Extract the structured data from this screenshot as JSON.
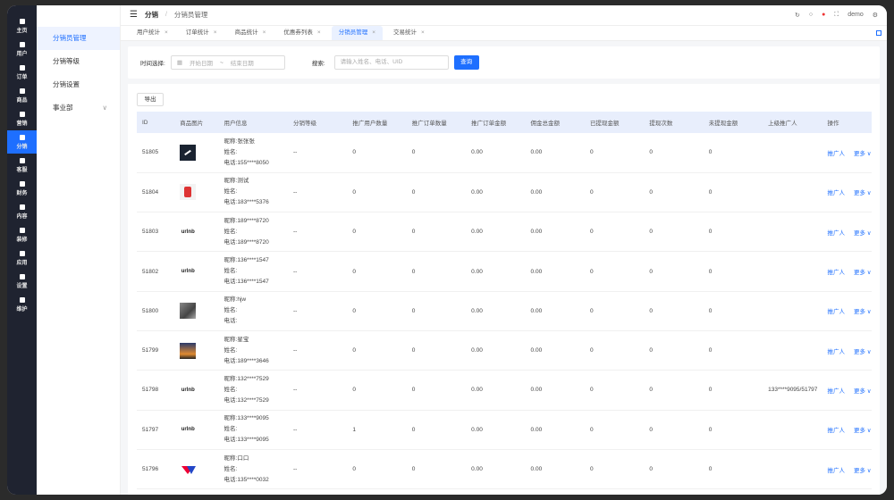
{
  "rail": {
    "items": [
      {
        "label": "主页",
        "active": false
      },
      {
        "label": "用户",
        "active": false
      },
      {
        "label": "订单",
        "active": false
      },
      {
        "label": "商品",
        "active": false
      },
      {
        "label": "营销",
        "active": false
      },
      {
        "label": "分销",
        "active": true
      },
      {
        "label": "客服",
        "active": false
      },
      {
        "label": "财务",
        "active": false
      },
      {
        "label": "内容",
        "active": false
      },
      {
        "label": "装修",
        "active": false
      },
      {
        "label": "应用",
        "active": false
      },
      {
        "label": "设置",
        "active": false
      },
      {
        "label": "维护",
        "active": false
      }
    ]
  },
  "submenu": {
    "items": [
      {
        "label": "分销员管理",
        "active": true
      },
      {
        "label": "分销等级",
        "active": false
      },
      {
        "label": "分销设置",
        "active": false
      },
      {
        "label": "事业部",
        "active": false
      }
    ]
  },
  "header": {
    "breadcrumb_main": "分销",
    "breadcrumb_sep": "/",
    "breadcrumb_sub": "分销员管理",
    "user": "demo"
  },
  "tabs": [
    {
      "label": "用户统计",
      "active": false
    },
    {
      "label": "订单统计",
      "active": false
    },
    {
      "label": "商品统计",
      "active": false
    },
    {
      "label": "优惠券列表",
      "active": false
    },
    {
      "label": "分销员管理",
      "active": true
    },
    {
      "label": "交易统计",
      "active": false
    }
  ],
  "filter": {
    "time_label": "时间选择:",
    "start_placeholder": "开始日期",
    "date_sep": "~",
    "end_placeholder": "结束日期",
    "search_label": "搜索:",
    "search_placeholder": "请输入姓名、电话、UID",
    "query_label": "查询"
  },
  "table": {
    "export_label": "导出",
    "columns": [
      "ID",
      "商品图片",
      "用户信息",
      "分销等级",
      "推广用户数量",
      "推广订单数量",
      "推广订单金额",
      "佣金总金额",
      "已提现金额",
      "提现次数",
      "未提现金额",
      "上级推广人",
      "操作"
    ],
    "op_promoter": "推广人",
    "op_more": "更多 ∨",
    "rows": [
      {
        "id": "51805",
        "thumb": "dark",
        "nick": "昵称:张张张",
        "name": "姓名:",
        "phone": "电话:155****8050",
        "level": "--",
        "users": "0",
        "orders": "0",
        "amount": "0.00",
        "commission": "0.00",
        "withdrawn": "0",
        "times": "0",
        "unwithdrawn": "0",
        "parent": ""
      },
      {
        "id": "51804",
        "thumb": "red",
        "nick": "昵称:测试",
        "name": "姓名:",
        "phone": "电话:183****5376",
        "level": "--",
        "users": "0",
        "orders": "0",
        "amount": "0.00",
        "commission": "0.00",
        "withdrawn": "0",
        "times": "0",
        "unwithdrawn": "0",
        "parent": ""
      },
      {
        "id": "51803",
        "thumb": "logo",
        "nick": "昵称:189****8720",
        "name": "姓名:",
        "phone": "电话:189****8720",
        "level": "--",
        "users": "0",
        "orders": "0",
        "amount": "0.00",
        "commission": "0.00",
        "withdrawn": "0",
        "times": "0",
        "unwithdrawn": "0",
        "parent": ""
      },
      {
        "id": "51802",
        "thumb": "logo",
        "nick": "昵称:136****1547",
        "name": "姓名:",
        "phone": "电话:136****1547",
        "level": "--",
        "users": "0",
        "orders": "0",
        "amount": "0.00",
        "commission": "0.00",
        "withdrawn": "0",
        "times": "0",
        "unwithdrawn": "0",
        "parent": ""
      },
      {
        "id": "51800",
        "thumb": "photo1",
        "nick": "昵称:hjw",
        "name": "姓名:",
        "phone": "电话:",
        "level": "--",
        "users": "0",
        "orders": "0",
        "amount": "0.00",
        "commission": "0.00",
        "withdrawn": "0",
        "times": "0",
        "unwithdrawn": "0",
        "parent": ""
      },
      {
        "id": "51799",
        "thumb": "photo2",
        "nick": "昵称:星宝",
        "name": "姓名:",
        "phone": "电话:189****3646",
        "level": "--",
        "users": "0",
        "orders": "0",
        "amount": "0.00",
        "commission": "0.00",
        "withdrawn": "0",
        "times": "0",
        "unwithdrawn": "0",
        "parent": ""
      },
      {
        "id": "51798",
        "thumb": "logo",
        "nick": "昵称:132****7529",
        "name": "姓名:",
        "phone": "电话:132****7529",
        "level": "--",
        "users": "0",
        "orders": "0",
        "amount": "0.00",
        "commission": "0.00",
        "withdrawn": "0",
        "times": "0",
        "unwithdrawn": "0",
        "parent": "133****9095/51797"
      },
      {
        "id": "51797",
        "thumb": "logo",
        "nick": "昵称:133****9095",
        "name": "姓名:",
        "phone": "电话:133****9095",
        "level": "--",
        "users": "1",
        "orders": "0",
        "amount": "0.00",
        "commission": "0.00",
        "withdrawn": "0",
        "times": "0",
        "unwithdrawn": "0",
        "parent": ""
      },
      {
        "id": "51796",
        "thumb": "wlogo",
        "nick": "昵称:口口",
        "name": "姓名:",
        "phone": "电话:135****0032",
        "level": "--",
        "users": "0",
        "orders": "0",
        "amount": "0.00",
        "commission": "0.00",
        "withdrawn": "0",
        "times": "0",
        "unwithdrawn": "0",
        "parent": ""
      }
    ]
  },
  "logo_text": "urlnb"
}
